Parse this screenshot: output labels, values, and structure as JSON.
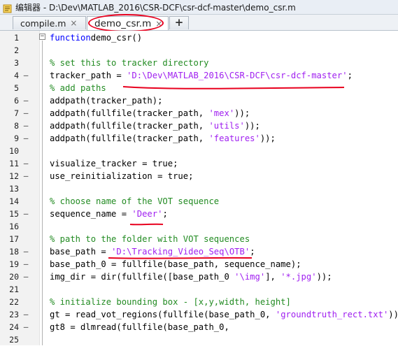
{
  "window": {
    "title": "编辑器 - D:\\Dev\\MATLAB_2016\\CSR-DCF\\csr-dcf-master\\demo_csr.m"
  },
  "tabs": [
    {
      "label": "compile.m",
      "close": "×",
      "active": false
    },
    {
      "label": "demo_csr.m",
      "close": "×",
      "active": true
    }
  ],
  "add_tab_label": "+",
  "colors": {
    "keyword": "#0000ff",
    "comment": "#228b22",
    "string": "#a020f0",
    "annotation": "#e8001e"
  },
  "lines": [
    {
      "num": "1",
      "marker": "",
      "segs": [
        [
          "kw",
          "function"
        ],
        [
          "",
          "demo_csr()"
        ]
      ]
    },
    {
      "num": "2",
      "marker": "",
      "segs": []
    },
    {
      "num": "3",
      "marker": "",
      "segs": [
        [
          "cm",
          "% set this to tracker directory"
        ]
      ]
    },
    {
      "num": "4",
      "marker": "–",
      "segs": [
        [
          "",
          "tracker_path = "
        ],
        [
          "str",
          "'D:\\Dev\\MATLAB_2016\\CSR-DCF\\csr-dcf-master'"
        ],
        [
          "",
          ";"
        ]
      ]
    },
    {
      "num": "5",
      "marker": "",
      "segs": [
        [
          "cm",
          "% add paths"
        ]
      ]
    },
    {
      "num": "6",
      "marker": "–",
      "segs": [
        [
          "",
          "addpath(tracker_path);"
        ]
      ]
    },
    {
      "num": "7",
      "marker": "–",
      "segs": [
        [
          "",
          "addpath(fullfile(tracker_path, "
        ],
        [
          "str",
          "'mex'"
        ],
        [
          "",
          "));"
        ]
      ]
    },
    {
      "num": "8",
      "marker": "–",
      "segs": [
        [
          "",
          "addpath(fullfile(tracker_path, "
        ],
        [
          "str",
          "'utils'"
        ],
        [
          "",
          "));"
        ]
      ]
    },
    {
      "num": "9",
      "marker": "–",
      "segs": [
        [
          "",
          "addpath(fullfile(tracker_path, "
        ],
        [
          "str",
          "'features'"
        ],
        [
          "",
          "));"
        ]
      ]
    },
    {
      "num": "10",
      "marker": "",
      "segs": []
    },
    {
      "num": "11",
      "marker": "–",
      "segs": [
        [
          "",
          "visualize_tracker = true;"
        ]
      ]
    },
    {
      "num": "12",
      "marker": "–",
      "segs": [
        [
          "",
          "use_reinitialization = true;"
        ]
      ]
    },
    {
      "num": "13",
      "marker": "",
      "segs": []
    },
    {
      "num": "14",
      "marker": "",
      "segs": [
        [
          "cm",
          "% choose name of the VOT sequence"
        ]
      ]
    },
    {
      "num": "15",
      "marker": "–",
      "segs": [
        [
          "",
          "sequence_name = "
        ],
        [
          "str",
          "'Deer'"
        ],
        [
          "",
          ";"
        ]
      ]
    },
    {
      "num": "16",
      "marker": "",
      "segs": []
    },
    {
      "num": "17",
      "marker": "",
      "segs": [
        [
          "cm",
          "% path to the folder with VOT sequences"
        ]
      ]
    },
    {
      "num": "18",
      "marker": "–",
      "segs": [
        [
          "",
          "base_path = "
        ],
        [
          "str",
          "'D:\\Tracking_Video_Seq\\OTB'"
        ],
        [
          "",
          ";"
        ]
      ]
    },
    {
      "num": "19",
      "marker": "–",
      "segs": [
        [
          "",
          "base_path_0 = fullfile(base_path, sequence_name);"
        ]
      ]
    },
    {
      "num": "20",
      "marker": "–",
      "segs": [
        [
          "",
          "img_dir = dir(fullfile([base_path_0 "
        ],
        [
          "str",
          "'\\img'"
        ],
        [
          "",
          "], "
        ],
        [
          "str",
          "'*.jpg'"
        ],
        [
          "",
          "));"
        ]
      ]
    },
    {
      "num": "21",
      "marker": "",
      "segs": []
    },
    {
      "num": "22",
      "marker": "",
      "segs": [
        [
          "cm",
          "% initialize bounding box - [x,y,width, height]"
        ]
      ]
    },
    {
      "num": "23",
      "marker": "–",
      "segs": [
        [
          "",
          "gt = read_vot_regions(fullfile(base_path_0, "
        ],
        [
          "str",
          "'groundtruth_rect.txt'"
        ],
        [
          "",
          "));"
        ]
      ]
    },
    {
      "num": "24",
      "marker": "–",
      "segs": [
        [
          "",
          "gt8 = dlmread(fullfile(base_path_0,"
        ]
      ]
    },
    {
      "num": "25",
      "marker": "",
      "segs": []
    }
  ]
}
